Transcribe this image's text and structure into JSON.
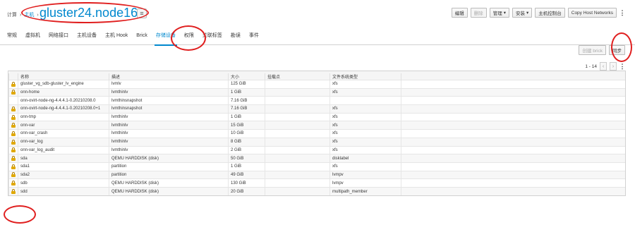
{
  "breadcrumb": {
    "root": "计算",
    "hosts": "主机",
    "sep": "›"
  },
  "title": "gluster24.node16",
  "actions": {
    "edit": "编辑",
    "remove": "删除",
    "manage": "管理",
    "install": "安装",
    "host_console": "主机控制台",
    "copy_host_networks": "Copy Host Networks"
  },
  "tabs": [
    "常规",
    "虚拟机",
    "网络接口",
    "主机设备",
    "主机 Hook",
    "Brick",
    "存储设备",
    "权限",
    "关联标签",
    "勘误",
    "事件"
  ],
  "active_tab": "存储设备",
  "toolbar": {
    "create_brick": "创建 brick",
    "sync": "同步"
  },
  "pager": {
    "range": "1 - 14"
  },
  "table": {
    "columns": [
      "名称",
      "描述",
      "大小",
      "挂载点",
      "文件系统类型"
    ],
    "rows": [
      {
        "locked": true,
        "name": "gluster_vg_sdb-gluster_lv_engine",
        "desc": "lvmlv",
        "size": "125 GiB",
        "mount": "",
        "fs": "xfs"
      },
      {
        "locked": true,
        "name": "onn-home",
        "desc": "lvmthinlv",
        "size": "1 GiB",
        "mount": "",
        "fs": "xfs"
      },
      {
        "locked": false,
        "name": "onn-ovirt-node-ng-4.4.4.1-0.20210208.0",
        "desc": "lvmthinsnapshot",
        "size": "7.16 GiB",
        "mount": "",
        "fs": ""
      },
      {
        "locked": true,
        "name": "onn-ovirt-node-ng-4.4.4.1-0.20210208.0+1",
        "desc": "lvmthinsnapshot",
        "size": "7.16 GiB",
        "mount": "",
        "fs": "xfs"
      },
      {
        "locked": true,
        "name": "onn-tmp",
        "desc": "lvmthinlv",
        "size": "1 GiB",
        "mount": "",
        "fs": "xfs"
      },
      {
        "locked": true,
        "name": "onn-var",
        "desc": "lvmthinlv",
        "size": "15 GiB",
        "mount": "",
        "fs": "xfs"
      },
      {
        "locked": true,
        "name": "onn-var_crash",
        "desc": "lvmthinlv",
        "size": "10 GiB",
        "mount": "",
        "fs": "xfs"
      },
      {
        "locked": true,
        "name": "onn-var_log",
        "desc": "lvmthinlv",
        "size": "8 GiB",
        "mount": "",
        "fs": "xfs"
      },
      {
        "locked": true,
        "name": "onn-var_log_audit",
        "desc": "lvmthinlv",
        "size": "2 GiB",
        "mount": "",
        "fs": "xfs"
      },
      {
        "locked": true,
        "name": "sda",
        "desc": "QEMU HARDDISK (disk)",
        "size": "50 GiB",
        "mount": "",
        "fs": "disklabel"
      },
      {
        "locked": true,
        "name": "sda1",
        "desc": "partition",
        "size": "1 GiB",
        "mount": "",
        "fs": "xfs"
      },
      {
        "locked": true,
        "name": "sda2",
        "desc": "partition",
        "size": "49 GiB",
        "mount": "",
        "fs": "lvmpv"
      },
      {
        "locked": true,
        "name": "sdb",
        "desc": "QEMU HARDDISK (disk)",
        "size": "130 GiB",
        "mount": "",
        "fs": "lvmpv"
      },
      {
        "locked": true,
        "name": "sdd",
        "desc": "QEMU HARDDISK (disk)",
        "size": "20 GiB",
        "mount": "",
        "fs": "multipath_member"
      }
    ]
  },
  "colors": {
    "accent": "#0088ce",
    "annotation": "#e01f1f",
    "lock": "#e0a800"
  }
}
